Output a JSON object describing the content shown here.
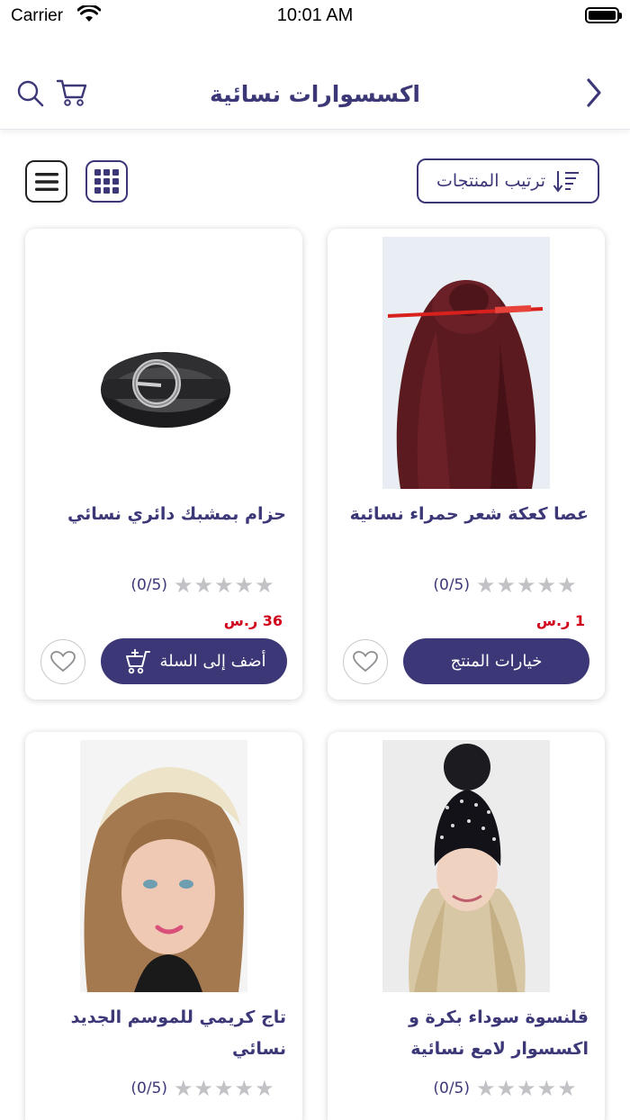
{
  "status_bar": {
    "carrier": "Carrier",
    "time": "10:01 AM"
  },
  "header": {
    "title": "اكسسوارات نسائية"
  },
  "toolbar": {
    "sort_label": "ترتيب المنتجات"
  },
  "products": [
    {
      "name": "عصا كعكة شعر حمراء نسائية",
      "rating": "(0/5)",
      "price": "1 ر.س",
      "action": "خيارات المنتج",
      "image": "hair-bun-stick-photo"
    },
    {
      "name": "حزام بمشبك دائري نسائي",
      "rating": "(0/5)",
      "price": "36 ر.س",
      "action": "أضف إلى السلة",
      "image": "black-belt-photo"
    },
    {
      "name": "قلنسوة سوداء بكرة و اكسسوار لامع نسائية",
      "rating": "(0/5)",
      "price": "",
      "action": "",
      "image": "black-beanie-photo"
    },
    {
      "name": "تاج كريمي للموسم الجديد نسائي",
      "rating": "(0/5)",
      "price": "",
      "action": "",
      "image": "cream-headband-photo"
    }
  ],
  "colors": {
    "brand": "#3c3878",
    "price": "#d0021b",
    "star": "#c2c2c6"
  }
}
